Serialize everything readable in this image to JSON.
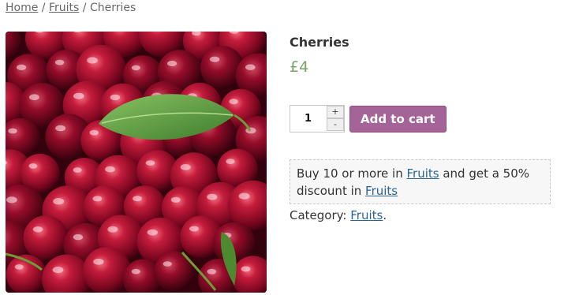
{
  "breadcrumb": {
    "home": "Home",
    "sep1": " / ",
    "fruits": "Fruits",
    "sep2": " / ",
    "current": "Cherries"
  },
  "product": {
    "title": "Cherries",
    "price": "£4",
    "image_icon": "cherries-photo"
  },
  "cart": {
    "quantity": "1",
    "plus": "+",
    "minus": "-",
    "add_label": "Add to cart",
    "button_color": "#a46497"
  },
  "promo": {
    "t1": "Buy 10 or more in ",
    "link1": "Fruits",
    "t2": " and get a 50% discount in ",
    "link2": "Fruits"
  },
  "category": {
    "label": "Category: ",
    "link": "Fruits",
    "end": "."
  },
  "colors": {
    "price": "#77a464",
    "link": "#2a6496"
  }
}
